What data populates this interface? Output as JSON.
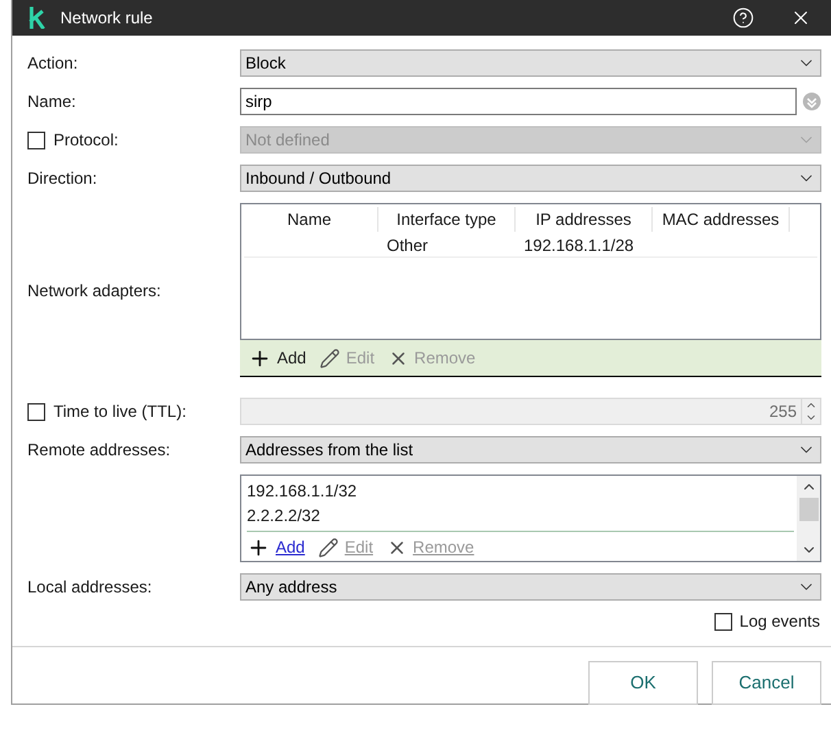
{
  "window": {
    "title": "Network rule"
  },
  "action": {
    "label": "Action:",
    "value": "Block",
    "disabled": false
  },
  "name": {
    "label": "Name:",
    "value": "sirp"
  },
  "protocol": {
    "label": "Protocol:",
    "checked": false,
    "value": "Not defined",
    "disabled": true
  },
  "direction": {
    "label": "Direction:",
    "value": "Inbound / Outbound",
    "disabled": false
  },
  "network_adapters": {
    "label": "Network adapters:",
    "columns": [
      "Name",
      "Interface type",
      "IP addresses",
      "MAC addresses"
    ],
    "rows": [
      {
        "interface_type": "Other",
        "ip_addresses": "192.168.1.1/28"
      }
    ],
    "actions": [
      {
        "kind": "add",
        "label": "Add",
        "disabled": false
      },
      {
        "kind": "edit",
        "label": "Edit",
        "disabled": true
      },
      {
        "kind": "remove",
        "label": "Remove",
        "disabled": true
      }
    ]
  },
  "ttl": {
    "label": "Time to live (TTL):",
    "checked": false,
    "value": "255",
    "disabled": true
  },
  "remote_addresses": {
    "label": "Remote addresses:",
    "value": "Addresses from the list",
    "disabled": false,
    "items": [
      "192.168.1.1/32",
      "2.2.2.2/32"
    ],
    "actions": [
      {
        "kind": "add",
        "label": "Add",
        "disabled": false
      },
      {
        "kind": "edit",
        "label": "Edit",
        "disabled": true
      },
      {
        "kind": "remove",
        "label": "Remove",
        "disabled": true
      }
    ]
  },
  "local_addresses": {
    "label": "Local addresses:",
    "value": "Any address",
    "disabled": false
  },
  "log_events": {
    "label": "Log events",
    "checked": false
  },
  "buttons": [
    "OK",
    "Cancel"
  ]
}
